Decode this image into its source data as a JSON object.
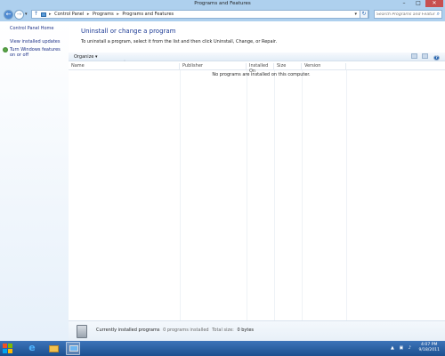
{
  "window": {
    "title": "Programs and Features",
    "controls": {
      "minimize": "–",
      "maximize": "□",
      "close": "✕"
    }
  },
  "navigation": {
    "back_glyph": "←",
    "forward_glyph": "→",
    "recent_glyph": "▾",
    "up_glyph": "↑",
    "breadcrumbs": [
      "Control Panel",
      "Programs",
      "Programs and Features"
    ],
    "separator": "▸",
    "refresh_glyph": "↻",
    "search_placeholder": "Search Programs and Features",
    "search_glyph": "⌕"
  },
  "sidebar": {
    "home": "Control Panel Home",
    "updates": "View installed updates",
    "features": "Turn Windows features on or off"
  },
  "main": {
    "heading": "Uninstall or change a program",
    "subtext": "To uninstall a program, select it from the list and then click Uninstall, Change, or Repair.",
    "organize": "Organize ▾",
    "view_icons": [
      "view-options-icon",
      "preview-pane-icon",
      "help-icon"
    ],
    "help_glyph": "?",
    "columns": [
      "Name",
      "Publisher",
      "Installed On",
      "Size",
      "Version"
    ],
    "sort_glyph": "˄",
    "empty_message": "No programs are installed on this computer."
  },
  "details": {
    "title": "Currently installed programs",
    "programs_installed": "0 programs installed",
    "total_size_label": "Total size:",
    "total_size": "0 bytes"
  },
  "taskbar": {
    "ie_glyph": "e",
    "tray_icons": [
      "▲",
      "▣",
      "♪"
    ],
    "time": "4:07 PM",
    "date": "9/18/2011"
  },
  "colors": {
    "accent": "#1e3c96",
    "link": "#1e3287",
    "taskbar": "#2a5fa3",
    "close_button": "#c75050"
  }
}
